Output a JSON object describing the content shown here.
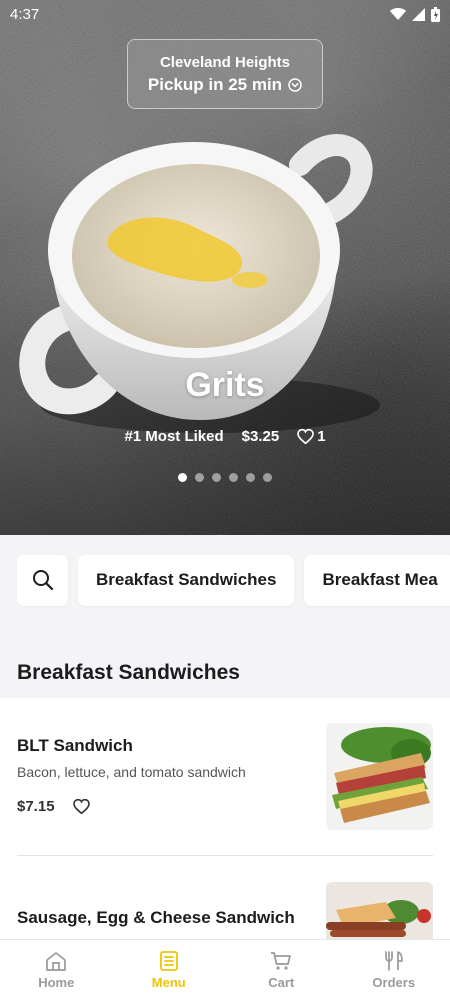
{
  "status_bar": {
    "time": "4:37"
  },
  "location": {
    "name": "Cleveland Heights",
    "pickup": "Pickup in 25 min"
  },
  "hero": {
    "title": "Grits",
    "badge": "#1 Most Liked",
    "price": "$3.25",
    "likes": "1",
    "slides": 6,
    "active_slide": 1
  },
  "categories": {
    "items": [
      "Breakfast Sandwiches",
      "Breakfast Mea"
    ]
  },
  "section": {
    "title": "Breakfast Sandwiches"
  },
  "menu_items": [
    {
      "name": "BLT Sandwich",
      "description": "Bacon, lettuce, and tomato sandwich",
      "price": "$7.15"
    },
    {
      "name": "Sausage, Egg & Cheese Sandwich"
    }
  ],
  "tabs": [
    {
      "label": "Home",
      "icon": "home-icon"
    },
    {
      "label": "Menu",
      "icon": "menu-icon"
    },
    {
      "label": "Cart",
      "icon": "cart-icon"
    },
    {
      "label": "Orders",
      "icon": "utensils-icon"
    }
  ],
  "active_tab": "Menu",
  "colors": {
    "accent": "#f2c400",
    "background": "#f4f4f6"
  }
}
